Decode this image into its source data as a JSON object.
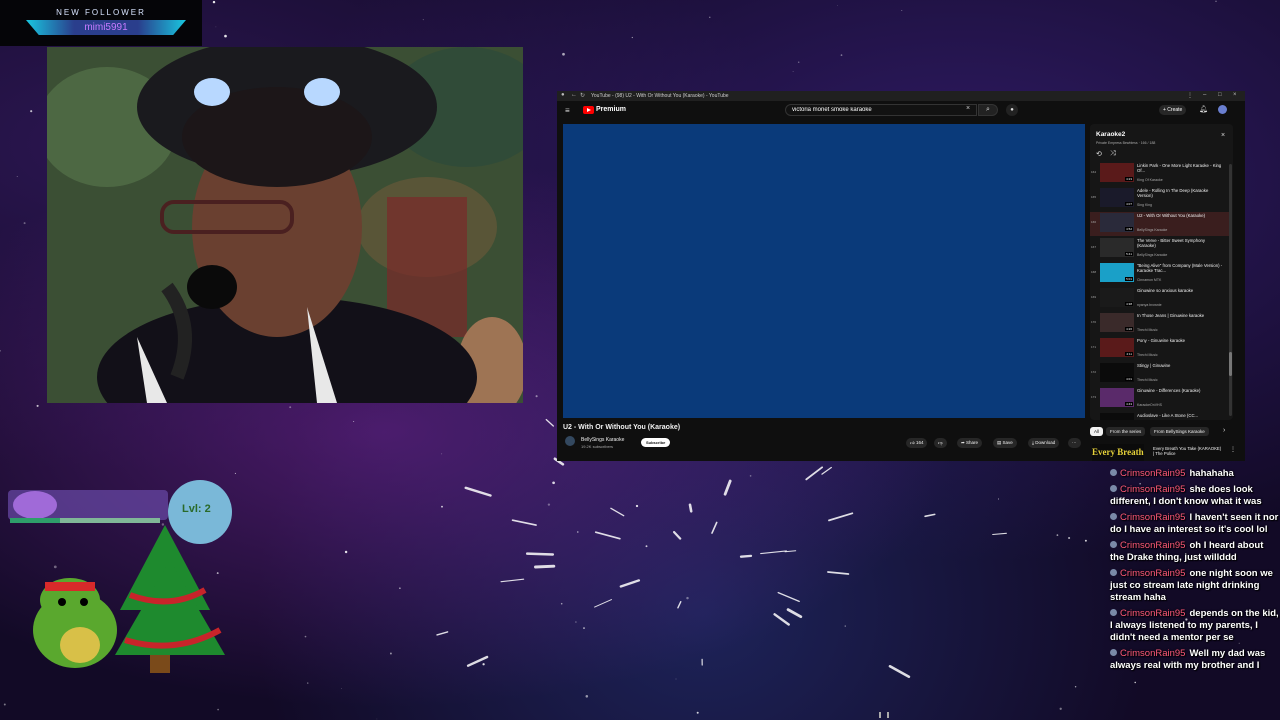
{
  "overlay": {
    "follower_label": "NEW FOLLOWER",
    "follower_name": "mimi5991"
  },
  "browser": {
    "tab_title": "YouTube - (98) U2 - With Or Without You (Karaoke) - YouTube",
    "menu_icon": "hamburger-menu-icon",
    "brand": "Premium",
    "search_value": "victoria monet smoke karaoke",
    "create_label": "+ Create",
    "notification_badge": "9+"
  },
  "video": {
    "title": "U2 - With Or Without You (Karaoke)",
    "channel": "BellySings Karaoke",
    "subscribers": "19.2K subscribers",
    "subscribe_label": "Subscribe",
    "likes": "164",
    "share_label": "Share",
    "save_label": "Save",
    "download_label": "Download",
    "player_color": "#0a3a7a"
  },
  "playlist": {
    "title": "Karaoke2",
    "subtitle": "Private  Empress Bewbless · 166 / 188",
    "items": [
      {
        "index": "164",
        "title": "Linkin Park - One More Light Karaoke - King Of...",
        "channel": "King Of Karaoke",
        "duration": "4:23",
        "thumb": "#5a1a1a",
        "active": false
      },
      {
        "index": "165",
        "title": "Adele - Rolling In The Deep (Karaoke Version)",
        "channel": "Sing King",
        "duration": "4:07",
        "thumb": "#1a1a2a",
        "active": false
      },
      {
        "index": "166",
        "title": "U2 - With Or Without You (Karaoke)",
        "channel": "BellySings Karaoke",
        "duration": "4:52",
        "thumb": "#2a2a3a",
        "active": true
      },
      {
        "index": "167",
        "title": "The Verve - Bitter Sweet Symphony (Karaoke)",
        "channel": "BellySings Karaoke",
        "duration": "5:41",
        "thumb": "#2a2a2a",
        "active": false
      },
      {
        "index": "168",
        "title": "\"Being Alive\" from Company (Male Version) - Karaoke Trac...",
        "channel": "Cinnamon MTK",
        "duration": "5:01",
        "thumb": "#1aa0c8",
        "active": false
      },
      {
        "index": "169",
        "title": "Ginuwine so anxious karaoke",
        "channel": "nyanya brownie",
        "duration": "4:38",
        "thumb": "#1a1a1a",
        "active": false
      },
      {
        "index": "170",
        "title": "In Those Jeans | Ginuwine karaoke",
        "channel": "Thechi Music",
        "duration": "4:26",
        "thumb": "#3a2a2a",
        "active": false
      },
      {
        "index": "171",
        "title": "Pony - Ginuwine karaoke",
        "channel": "Thechi Music",
        "duration": "4:11",
        "thumb": "#5a1a1a",
        "active": false
      },
      {
        "index": "172",
        "title": "Stingy | Ginuwine",
        "channel": "Thechi Music",
        "duration": "4:01",
        "thumb": "#0b0b0b",
        "active": false
      },
      {
        "index": "173",
        "title": "Ginuwine - Differences (Karaoke)",
        "channel": "KaraokeOnVHS",
        "duration": "4:43",
        "thumb": "#5a2a6a",
        "active": false
      },
      {
        "index": "174",
        "title": "Audioslave - Like A Stone (CC...",
        "channel": "",
        "duration": "",
        "thumb": "#0b0b0b",
        "active": false
      }
    ]
  },
  "chips": [
    "All",
    "From the series",
    "From BellySings Karaoke"
  ],
  "recommendation": {
    "thumb_text": "Every Breath",
    "title": "Every Breath You Take (KARAOKE) | The Police"
  },
  "chat": [
    {
      "user": "CrimsonRain95",
      "text": "hahahaha"
    },
    {
      "user": "CrimsonRain95",
      "text": "she does look different, I don't know what it was"
    },
    {
      "user": "CrimsonRain95",
      "text": "I haven't seen it nor do I have an interest so it's cool lol"
    },
    {
      "user": "CrimsonRain95",
      "text": "oh I heard about the Drake thing, just willddd"
    },
    {
      "user": "CrimsonRain95",
      "text": "one night soon we just co stream late night drinking stream haha"
    },
    {
      "user": "CrimsonRain95",
      "text": "depends on the kid, I always listened to my parents, I didn't need a mentor per se"
    },
    {
      "user": "CrimsonRain95",
      "text": "Well my dad was always real with my brother and I"
    }
  ],
  "pet": {
    "level": "Lvl: 2"
  }
}
